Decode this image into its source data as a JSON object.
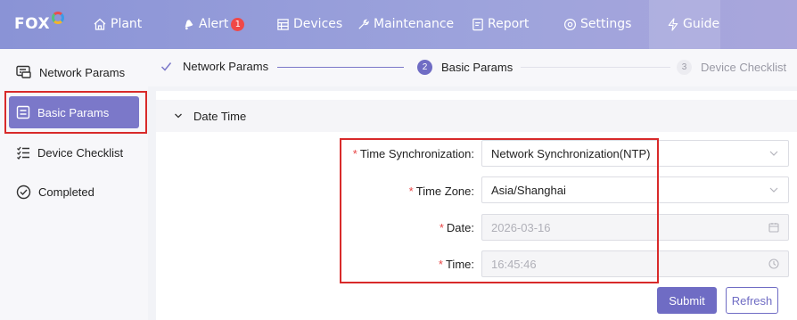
{
  "header": {
    "logo_text": "FOX",
    "nav": {
      "plant": "Plant",
      "alert": "Alert",
      "alert_count": "1",
      "devices": "Devices",
      "maintenance": "Maintenance",
      "report": "Report",
      "settings": "Settings",
      "guide": "Guide"
    }
  },
  "sidebar": {
    "items": [
      {
        "label": "Network Params",
        "icon": "network-icon"
      },
      {
        "label": "Basic Params",
        "icon": "basic-params-icon",
        "active": true
      },
      {
        "label": "Device Checklist",
        "icon": "checklist-icon"
      },
      {
        "label": "Completed",
        "icon": "check-circle-icon"
      }
    ]
  },
  "steps": {
    "step1": {
      "label": "Network Params",
      "state": "done"
    },
    "step2": {
      "label": "Basic Params",
      "number": "2",
      "state": "active"
    },
    "step3": {
      "label": "Device Checklist",
      "number": "3",
      "state": "pending"
    }
  },
  "section": {
    "title": "Date Time"
  },
  "form": {
    "required_mark": "*",
    "time_sync": {
      "label": "Time Synchronization:",
      "value": "Network Synchronization(NTP)"
    },
    "time_zone": {
      "label": "Time Zone:",
      "value": "Asia/Shanghai"
    },
    "date": {
      "label": "Date:",
      "value": "2026-03-16"
    },
    "time": {
      "label": "Time:",
      "value": "16:45:46"
    }
  },
  "actions": {
    "submit": "Submit",
    "refresh": "Refresh"
  },
  "colors": {
    "accent": "#6f6cc4",
    "highlight": "#d82a2a",
    "required": "#e84545"
  }
}
